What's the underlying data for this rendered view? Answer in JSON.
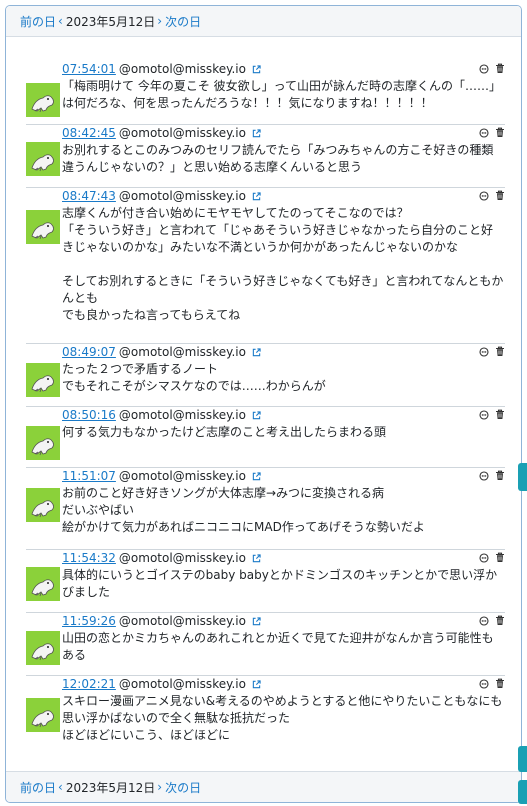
{
  "nav": {
    "prev_label": "前の日",
    "date": "2023年5月12日",
    "next_label": "次の日"
  },
  "posts": [
    {
      "time": "07:54:01",
      "user": "@omotol@misskey.io",
      "text": "「梅雨明けて 今年の夏こそ 彼女欲し」って山田が詠んだ時の志摩くんの「……」は何だろな、何を思ったんだろうな！！！気になりますね！！！！！"
    },
    {
      "time": "08:42:45",
      "user": "@omotol@misskey.io",
      "text": "お別れするとこのみつみのセリフ読んでたら「みつみちゃんの方こそ好きの種類違うんじゃないの？」と思い始める志摩くんいると思う"
    },
    {
      "time": "08:47:43",
      "user": "@omotol@misskey.io",
      "text": "志摩くんが付き合い始めにモヤモヤしてたのってそこなのでは？\n「そういう好き」と言われて「じゃあそういう好きじゃなかったら自分のこと好きじゃないのかな」みたいな不満というか何かがあったんじゃないのかな\n\nそしてお別れするときに「そういう好きじゃなくても好き」と言われてなんともかんとも\nでも良かったね言ってもらえてね"
    },
    {
      "time": "08:49:07",
      "user": "@omotol@misskey.io",
      "text": "たった２つで矛盾するノート\nでもそれこそがシマスケなのでは……わからんが"
    },
    {
      "time": "08:50:16",
      "user": "@omotol@misskey.io",
      "text": "何する気力もなかったけど志摩のこと考え出したらまわる頭"
    },
    {
      "time": "11:51:07",
      "user": "@omotol@misskey.io",
      "text": "お前のこと好き好きソングが大体志摩→みつに変換される病\nだいぶやばい\n絵がかけて気力があればニコニコにMAD作ってあげそうな勢いだよ"
    },
    {
      "time": "11:54:32",
      "user": "@omotol@misskey.io",
      "text": "具体的にいうとゴイステのbaby babyとかドミンゴスのキッチンとかで思い浮かびました"
    },
    {
      "time": "11:59:26",
      "user": "@omotol@misskey.io",
      "text": "山田の恋とかミカちゃんのあれこれとか近くで見てた迎井がなんか言う可能性もある"
    },
    {
      "time": "12:02:21",
      "user": "@omotol@misskey.io",
      "text": "スキロー漫画アニメ見ない&考えるのやめようとすると他にやりたいこともなにも思い浮かばないので全く無駄な抵抗だった\nほどほどにいこう、ほどほどに"
    }
  ],
  "colors": {
    "link": "#1a7ac8",
    "avatar": "#8bd13a",
    "side_tab": "#1aa0b4"
  }
}
